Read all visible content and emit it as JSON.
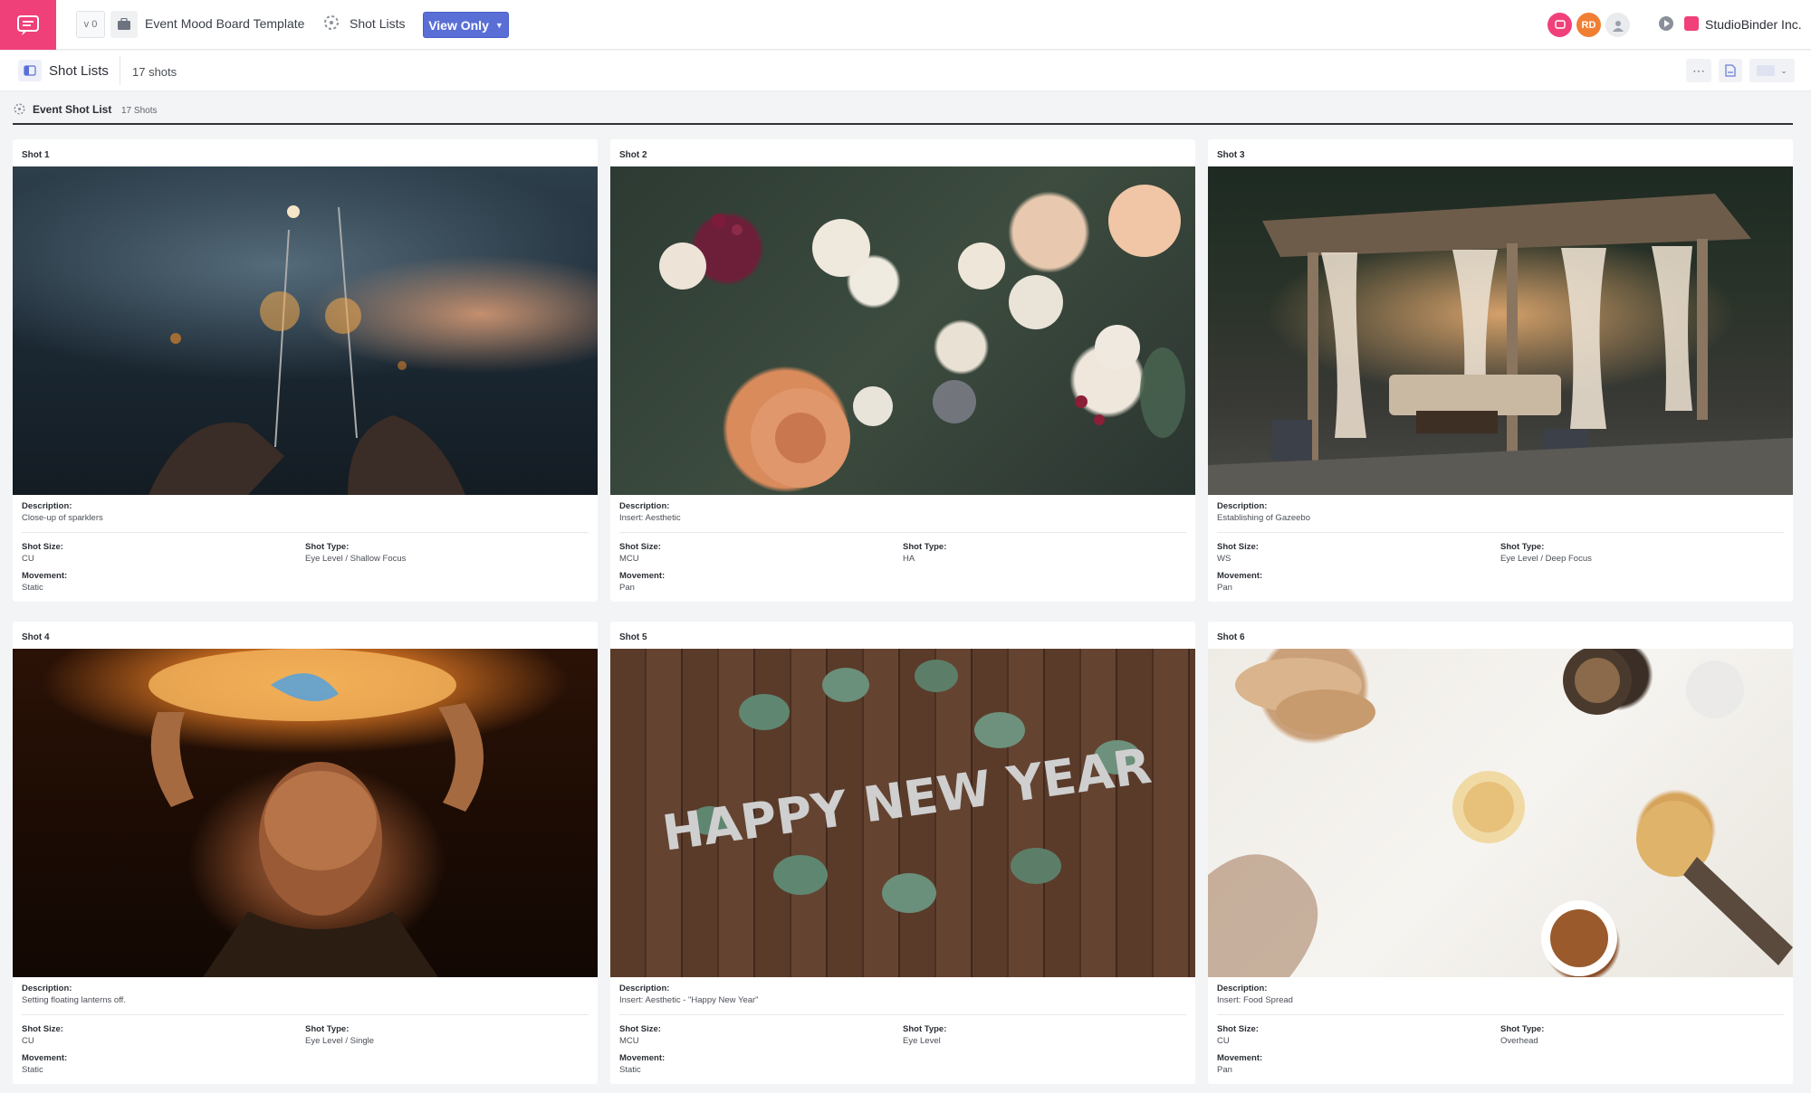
{
  "topbar": {
    "version": "v 0",
    "project_title": "Event Mood Board Template",
    "nav_label": "Shot Lists",
    "view_only_label": "View Only",
    "avatar_initials": "RD",
    "company": "StudioBinder Inc.",
    "accent": "#f0407a",
    "button_color": "#5a6fd6"
  },
  "subbar": {
    "title": "Shot Lists",
    "count": "17 shots"
  },
  "list": {
    "title": "Event Shot List",
    "count": "17 Shots"
  },
  "labels": {
    "description": "Description:",
    "shot_size": "Shot Size:",
    "shot_type": "Shot Type:",
    "movement": "Movement:"
  },
  "shots": [
    {
      "label": "Shot  1",
      "description": "Close-up of sparklers",
      "shot_size": "CU",
      "shot_type": "Eye Level / Shallow Focus",
      "movement": "Static"
    },
    {
      "label": "Shot  2",
      "description": "Insert: Aesthetic",
      "shot_size": "MCU",
      "shot_type": "HA",
      "movement": "Pan"
    },
    {
      "label": "Shot  3",
      "description": "Establishing of Gazeebo",
      "shot_size": "WS",
      "shot_type": "Eye Level / Deep Focus",
      "movement": "Pan"
    },
    {
      "label": "Shot  4",
      "description": "Setting floating lanterns off.",
      "shot_size": "CU",
      "shot_type": "Eye Level / Single",
      "movement": "Static"
    },
    {
      "label": "Shot  5",
      "description": "Insert: Aesthetic - \"Happy New Year\"",
      "shot_size": "MCU",
      "shot_type": "Eye Level",
      "movement": "Static",
      "image_text": "HAPPY NEW YEAR"
    },
    {
      "label": "Shot  6",
      "description": "Insert: Food Spread",
      "shot_size": "CU",
      "shot_type": "Overhead",
      "movement": "Pan"
    }
  ]
}
